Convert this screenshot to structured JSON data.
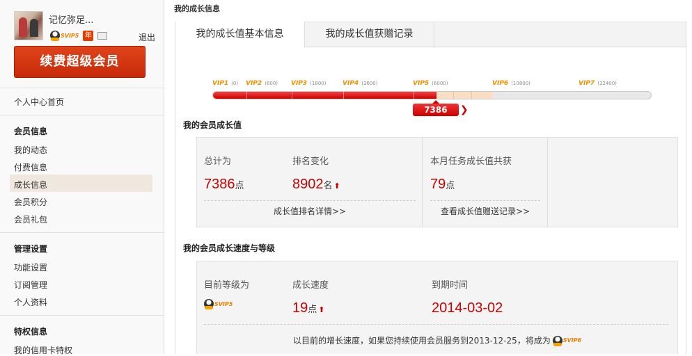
{
  "user": {
    "name": "记忆弥足...",
    "svip_badge": "SVIP5",
    "nian_badge": "年",
    "logout": "退出",
    "renew_button": "续费超级会员"
  },
  "sidebar": {
    "home": "个人中心首页",
    "groups": [
      {
        "title": "会员信息",
        "items": [
          "我的动态",
          "付费信息",
          "成长信息",
          "会员积分",
          "会员礼包"
        ]
      },
      {
        "title": "管理设置",
        "items": [
          "功能设置",
          "订阅管理",
          "个人资料"
        ]
      },
      {
        "title": "特权信息",
        "items": [
          "我的信用卡特权"
        ]
      }
    ],
    "active": "成长信息"
  },
  "page": {
    "title": "我的成长信息",
    "tabs": [
      "我的成长值基本信息",
      "我的成长值获赠记录"
    ]
  },
  "progress": {
    "current_value": 7386,
    "current_label": "7386",
    "max_value": 36000,
    "levels": [
      {
        "name": "VIP1",
        "threshold": "(0)"
      },
      {
        "name": "VIP2",
        "threshold": "(600)"
      },
      {
        "name": "VIP3",
        "threshold": "(1800)"
      },
      {
        "name": "VIP4",
        "threshold": "(3600)"
      },
      {
        "name": "VIP5",
        "threshold": "(6000)"
      },
      {
        "name": "VIP6",
        "threshold": "(10800)"
      },
      {
        "name": "VIP7",
        "threshold": "(32400)"
      }
    ]
  },
  "growth": {
    "section_title": "我的会员成长值",
    "total_label": "总计为",
    "total_value": "7386",
    "total_unit": "点",
    "rank_label": "排名变化",
    "rank_value": "8902",
    "rank_unit": "名",
    "rank_arrow": "⬆",
    "month_label": "本月任务成长值共获",
    "month_value": "79",
    "month_unit": "点",
    "rank_link": "成长值排名详情>>",
    "gift_link": "查看成长值赠送记录>>"
  },
  "speed": {
    "section_title": "我的会员成长速度与等级",
    "level_label": "目前等级为",
    "level_badge": "SVIP5",
    "speed_label": "成长速度",
    "speed_value": "19",
    "speed_unit": "点",
    "speed_arrow": "⬆",
    "expire_label": "到期时间",
    "expire_value": "2014-03-02",
    "note": "以目前的增长速度，如果您持续使用会员服务到2013-12-25，将成为",
    "note_badge": "SVIP6"
  },
  "colors": {
    "accent": "#cc0000",
    "vip": "#f29000"
  }
}
